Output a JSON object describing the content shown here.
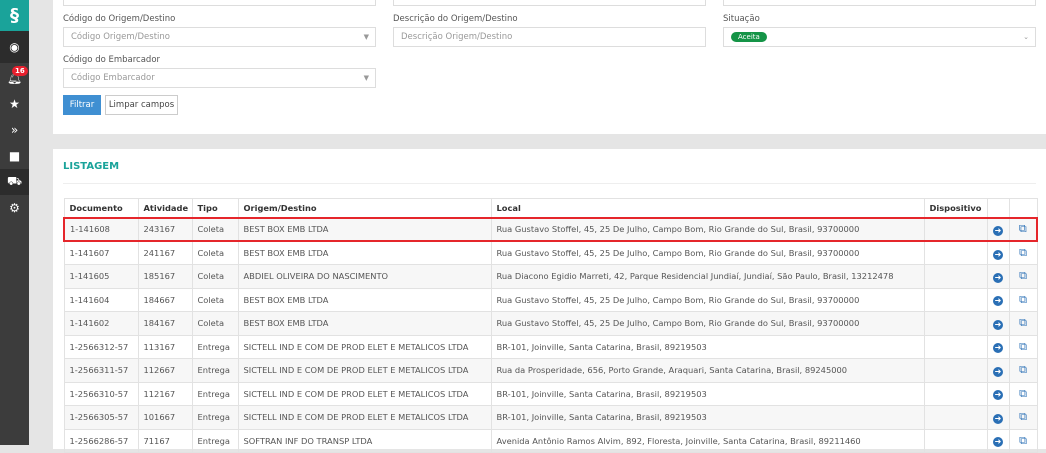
{
  "sidebar": {
    "badge_count": "16",
    "items": [
      "user",
      "notifications",
      "favorites",
      "navigate",
      "briefcase",
      "truck",
      "settings"
    ]
  },
  "filters": {
    "origem_codigo": {
      "label": "Código do Origem/Destino",
      "placeholder": "Código Origem/Destino"
    },
    "origem_descricao": {
      "label": "Descrição do Origem/Destino",
      "placeholder": "Descrição Origem/Destino"
    },
    "situacao": {
      "label": "Situação",
      "value": "Aceita"
    },
    "embarcador": {
      "label": "Código do Embarcador",
      "placeholder": "Código Embarcador"
    },
    "filter_button": "Filtrar",
    "clear_button": "Limpar campos"
  },
  "listing": {
    "title": "LISTAGEM",
    "columns": [
      "Documento",
      "Atividade",
      "Tipo",
      "Origem/Destino",
      "Local",
      "Dispositivo"
    ],
    "rows": [
      [
        "1-141608",
        "243167",
        "Coleta",
        "BEST BOX EMB LTDA",
        "Rua Gustavo Stoffel, 45, 25 De Julho, Campo Bom, Rio Grande do Sul, Brasil, 93700000",
        ""
      ],
      [
        "1-141607",
        "241167",
        "Coleta",
        "BEST BOX EMB LTDA",
        "Rua Gustavo Stoffel, 45, 25 De Julho, Campo Bom, Rio Grande do Sul, Brasil, 93700000",
        ""
      ],
      [
        "1-141605",
        "185167",
        "Coleta",
        "ABDIEL OLIVEIRA DO NASCIMENTO",
        "Rua Diacono Egidio Marreti, 42, Parque Residencial Jundiaí, Jundiaí, São Paulo, Brasil, 13212478",
        ""
      ],
      [
        "1-141604",
        "184667",
        "Coleta",
        "BEST BOX EMB LTDA",
        "Rua Gustavo Stoffel, 45, 25 De Julho, Campo Bom, Rio Grande do Sul, Brasil, 93700000",
        ""
      ],
      [
        "1-141602",
        "184167",
        "Coleta",
        "BEST BOX EMB LTDA",
        "Rua Gustavo Stoffel, 45, 25 De Julho, Campo Bom, Rio Grande do Sul, Brasil, 93700000",
        ""
      ],
      [
        "1-2566312-57",
        "113167",
        "Entrega",
        "SICTELL IND E COM DE PROD ELET E METALICOS LTDA",
        "BR-101, Joinville, Santa Catarina, Brasil, 89219503",
        ""
      ],
      [
        "1-2566311-57",
        "112667",
        "Entrega",
        "SICTELL IND E COM DE PROD ELET E METALICOS LTDA",
        "Rua da Prosperidade, 656, Porto Grande, Araquari, Santa Catarina, Brasil, 89245000",
        ""
      ],
      [
        "1-2566310-57",
        "112167",
        "Entrega",
        "SICTELL IND E COM DE PROD ELET E METALICOS LTDA",
        "BR-101, Joinville, Santa Catarina, Brasil, 89219503",
        ""
      ],
      [
        "1-2566305-57",
        "101667",
        "Entrega",
        "SICTELL IND E COM DE PROD ELET E METALICOS LTDA",
        "BR-101, Joinville, Santa Catarina, Brasil, 89219503",
        ""
      ],
      [
        "1-2566286-57",
        "71167",
        "Entrega",
        "SOFTRAN INF DO TRANSP LTDA",
        "Avenida Antônio Ramos Alvim, 892, Floresta, Joinville, Santa Catarina, Brasil, 89211460",
        ""
      ]
    ]
  }
}
